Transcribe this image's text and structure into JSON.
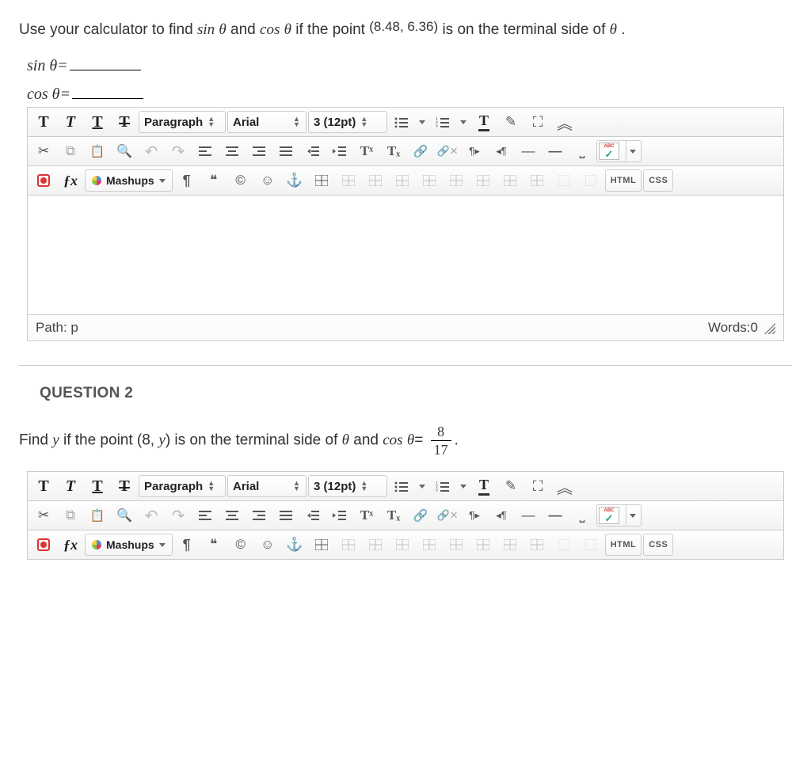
{
  "q1": {
    "prompt_prefix": "Use your calculator to find ",
    "fn1": "sin",
    "theta1": "θ",
    "and_text": " and ",
    "fn2": "cos",
    "theta2": "θ",
    "if_text": " if the point ",
    "point": "(8.48, 6.36)",
    "suffix": " is on the terminal side of ",
    "theta3": "θ",
    "period": ".",
    "sin_label": "sin θ=",
    "cos_label": "cos θ="
  },
  "toolbar": {
    "paragraph": "Paragraph",
    "font": "Arial",
    "size": "3 (12pt)",
    "mashups": "Mashups",
    "html": "HTML",
    "css": "CSS",
    "bold": "T",
    "italic": "T",
    "underline": "T",
    "strike": "T",
    "para": "¶",
    "quote": "❝",
    "copyright": "©",
    "smile": "☺",
    "anchor": "⚓",
    "sup": "Tˣ",
    "sub": "Tₓ",
    "link": "🔗",
    "unlink": "✂🔗",
    "ltr": "¶▸",
    "rtl": "◂¶",
    "hr_small": "—",
    "hr_big": "—",
    "nbsp": "⎵",
    "abc": "ABC",
    "check": "✓",
    "cut": "✂",
    "copy": "⧉",
    "paste": "📋",
    "find": "🔍",
    "undo": "↶",
    "redo": "↷",
    "fullscreen": "⛶",
    "collapse": "︽",
    "fx": "ƒx",
    "tcolor": "T",
    "highlight": "✎"
  },
  "footer": {
    "path": "Path: p",
    "words": "Words:0"
  },
  "q2": {
    "heading": "QUESTION 2",
    "prefix": "Find ",
    "y": "y",
    "mid": " if the point (8, ",
    "y2": "y",
    "mid2": ") is on the terminal side of ",
    "theta": "θ",
    "and": " and ",
    "cos": "cos",
    "theta2": "θ",
    "eq": "=",
    "num": "8",
    "den": "17",
    "period": "."
  }
}
